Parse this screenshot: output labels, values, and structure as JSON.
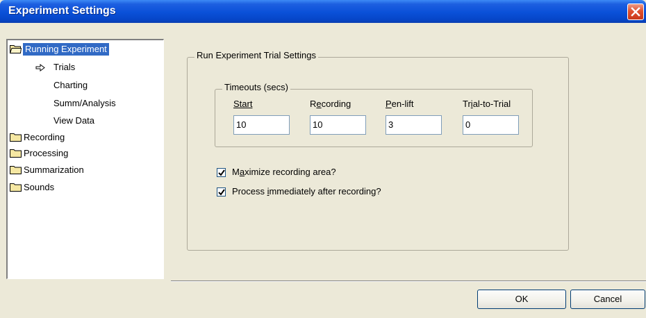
{
  "window": {
    "title": "Experiment Settings"
  },
  "tree": {
    "items": [
      {
        "label": "Running Experiment",
        "type": "folder",
        "selected": true,
        "level": 0
      },
      {
        "label": "Trials",
        "type": "arrow-child",
        "level": 1
      },
      {
        "label": "Charting",
        "type": "child",
        "level": 1
      },
      {
        "label": "Summ/Analysis",
        "type": "child",
        "level": 1
      },
      {
        "label": "View Data",
        "type": "child",
        "level": 1
      },
      {
        "label": "Recording",
        "type": "folder",
        "level": 0
      },
      {
        "label": "Processing",
        "type": "folder",
        "level": 0
      },
      {
        "label": "Summarization",
        "type": "folder",
        "level": 0
      },
      {
        "label": "Sounds",
        "type": "folder",
        "level": 0
      }
    ]
  },
  "panel": {
    "group_title": "Run Experiment Trial Settings",
    "timeouts": {
      "title": "Timeouts (secs)",
      "fields": [
        {
          "label": "Start",
          "value": "10",
          "access_key": "S"
        },
        {
          "label": "Recording",
          "value": "10",
          "access_key": "e"
        },
        {
          "label": "Pen-lift",
          "value": "3",
          "access_key": "P"
        },
        {
          "label": "Trial-to-Trial",
          "value": "0",
          "access_key": "i"
        }
      ]
    },
    "checkboxes": [
      {
        "label": "Maximize recording area?",
        "checked": true
      },
      {
        "label": "Process immediately after recording?",
        "checked": true
      }
    ]
  },
  "buttons": {
    "ok": "OK",
    "cancel": "Cancel"
  },
  "colors": {
    "titlebar": "#0a50d8",
    "selection": "#316ac5",
    "dialog_bg": "#ece9d8",
    "close": "#e0502f"
  },
  "icons": {
    "close": "close-x-icon",
    "folder": "folder-icon",
    "arrow": "arrow-right-icon",
    "check": "checkmark-icon"
  }
}
